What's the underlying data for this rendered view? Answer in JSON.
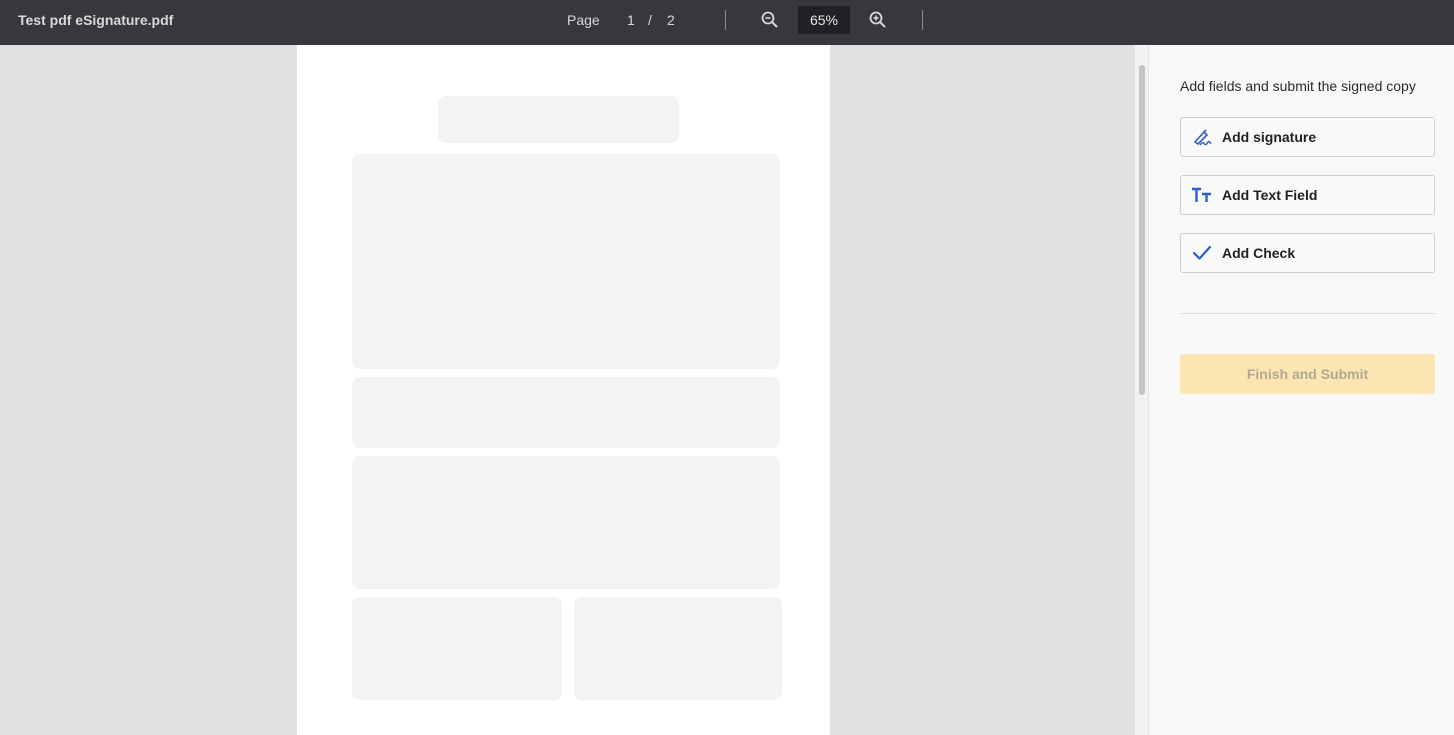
{
  "toolbar": {
    "document_title": "Test pdf eSignature.pdf",
    "page_label": "Page",
    "current_page": "1",
    "page_separator": "/",
    "total_pages": "2",
    "zoom": "65%",
    "zoom_out_icon": "zoom-out-icon",
    "zoom_in_icon": "zoom-in-icon"
  },
  "panel": {
    "heading": "Add fields and submit the signed copy",
    "actions": [
      {
        "label": "Add signature",
        "icon": "signature-icon"
      },
      {
        "label": "Add Text Field",
        "icon": "text-field-icon"
      },
      {
        "label": "Add Check",
        "icon": "check-icon"
      }
    ],
    "submit_label": "Finish and Submit",
    "submit_enabled": false
  },
  "colors": {
    "toolbar_bg": "#37383c",
    "accent_icon": "#2c5fc8",
    "submit_bg": "#fbe5b3"
  }
}
